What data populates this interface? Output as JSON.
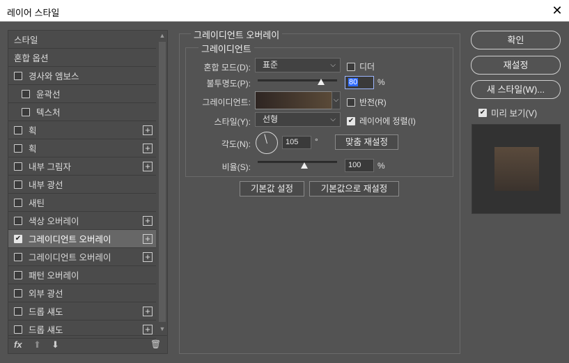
{
  "window": {
    "title": "레이어 스타일",
    "close_glyph": "✕"
  },
  "left_panel": {
    "items": [
      {
        "label": "스타일",
        "has_checkbox": false,
        "checked": false,
        "has_plus": false,
        "selected": false,
        "indent": false
      },
      {
        "label": "혼합 옵션",
        "has_checkbox": false,
        "checked": false,
        "has_plus": false,
        "selected": false,
        "indent": false
      },
      {
        "label": "경사와 엠보스",
        "has_checkbox": true,
        "checked": false,
        "has_plus": false,
        "selected": false,
        "indent": false
      },
      {
        "label": "윤곽선",
        "has_checkbox": true,
        "checked": false,
        "has_plus": false,
        "selected": false,
        "indent": true
      },
      {
        "label": "텍스처",
        "has_checkbox": true,
        "checked": false,
        "has_plus": false,
        "selected": false,
        "indent": true
      },
      {
        "label": "획",
        "has_checkbox": true,
        "checked": false,
        "has_plus": true,
        "selected": false,
        "indent": false
      },
      {
        "label": "획",
        "has_checkbox": true,
        "checked": false,
        "has_plus": true,
        "selected": false,
        "indent": false
      },
      {
        "label": "내부 그림자",
        "has_checkbox": true,
        "checked": false,
        "has_plus": true,
        "selected": false,
        "indent": false
      },
      {
        "label": "내부 광선",
        "has_checkbox": true,
        "checked": false,
        "has_plus": false,
        "selected": false,
        "indent": false
      },
      {
        "label": "새틴",
        "has_checkbox": true,
        "checked": false,
        "has_plus": false,
        "selected": false,
        "indent": false
      },
      {
        "label": "색상 오버레이",
        "has_checkbox": true,
        "checked": false,
        "has_plus": true,
        "selected": false,
        "indent": false
      },
      {
        "label": "그레이디언트 오버레이",
        "has_checkbox": true,
        "checked": true,
        "has_plus": true,
        "selected": true,
        "indent": false
      },
      {
        "label": "그레이디언트 오버레이",
        "has_checkbox": true,
        "checked": false,
        "has_plus": true,
        "selected": false,
        "indent": false
      },
      {
        "label": "패턴 오버레이",
        "has_checkbox": true,
        "checked": false,
        "has_plus": false,
        "selected": false,
        "indent": false
      },
      {
        "label": "외부 광선",
        "has_checkbox": true,
        "checked": false,
        "has_plus": false,
        "selected": false,
        "indent": false
      },
      {
        "label": "드롭 섀도",
        "has_checkbox": true,
        "checked": false,
        "has_plus": true,
        "selected": false,
        "indent": false
      },
      {
        "label": "드롭 섀도",
        "has_checkbox": true,
        "checked": false,
        "has_plus": true,
        "selected": false,
        "indent": false
      }
    ],
    "footer": {
      "fx": "fx",
      "up": "⬆",
      "down": "⬇",
      "trash": "🗑"
    }
  },
  "gradient_overlay": {
    "section_title": "그레이디언트 오버레이",
    "group_title": "그레이디언트",
    "blend_mode": {
      "label": "혼합 모드(D):",
      "value": "표준"
    },
    "dither": {
      "label": "디더",
      "checked": false
    },
    "opacity": {
      "label": "불투명도(P):",
      "value": "80",
      "unit": "%",
      "slider_fraction": 0.8
    },
    "gradient": {
      "label": "그레이디언트:",
      "from_color": "#2e2522",
      "to_color": "#5a4a38"
    },
    "reverse": {
      "label": "반전(R)",
      "checked": false
    },
    "style": {
      "label": "스타일(Y):",
      "value": "선형"
    },
    "align_with_layer": {
      "label": "레이어에 정렬(I)",
      "checked": true
    },
    "angle": {
      "label": "각도(N):",
      "value": "105",
      "unit": "°",
      "reset_label": "맞춤 재설정"
    },
    "scale": {
      "label": "비율(S):",
      "value": "100",
      "unit": "%",
      "slider_fraction": 0.5
    },
    "buttons": {
      "make_default": "기본값 설정",
      "reset_default": "기본값으로 재설정"
    }
  },
  "right_panel": {
    "ok": "확인",
    "reset": "재설정",
    "new_style": "새 스타일(W)...",
    "preview": {
      "label": "미리 보기(V)",
      "checked": true
    }
  }
}
